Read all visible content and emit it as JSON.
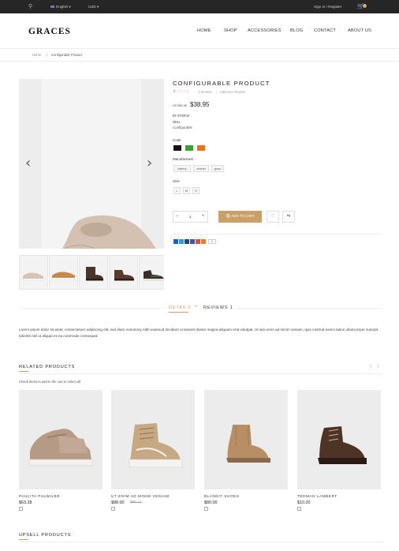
{
  "topbar": {
    "language": "English",
    "currency": "USD",
    "account_link": "Sign In / Register",
    "cart_count": "0"
  },
  "header": {
    "logo": "GRACES",
    "nav": [
      "HOME",
      "SHOP",
      "ACCESSORIES",
      "BLOG",
      "CONTACT",
      "ABOUT US"
    ]
  },
  "breadcrumb": [
    "Home",
    "Configurable Product"
  ],
  "product": {
    "title": "CONFIGURABLE PRODUCT",
    "review_count": "1 Review",
    "add_review": "Add Your Review",
    "price_prefix": "As low as",
    "price": "$38.95",
    "stock": "IN STOCK",
    "sku_label": "SKU",
    "sku_value": "Configurable",
    "color_label": "Color",
    "colors": [
      "#111111",
      "#3aa334",
      "#e8741f"
    ],
    "manufacturer_label": "Manufacturer",
    "manufacturer_required": "*",
    "manufacturers": [
      "bakery",
      "chanel",
      "gucci"
    ],
    "size_label": "Size",
    "sizes": [
      "L",
      "M",
      "S"
    ],
    "qty_minus": "−",
    "qty": "1",
    "qty_plus": "+",
    "add_to_cart": "ADD TO CART",
    "share_count": "0"
  },
  "tabs": {
    "details": "DETAILS",
    "reviews": "REVIEWS 1"
  },
  "description": "Lorem ipsum dolor sit amet, consectetuer adipiscing elit, sed diam nonummy nibh euismod tincidunt ut laoreet dolore magna aliquam erat volutpat. Ut wisi enim ad minim veniam, quis nostrud exerci tation ullamcorper suscipit lobortis nisl ut aliquip ex ea commodo consequat.",
  "related": {
    "title": "RELATED PRODUCTS",
    "hint": "Check items to add to the cart or select all",
    "items": [
      {
        "name": "PAULITA PULWILER",
        "price": "$63.28",
        "old_price": ""
      },
      {
        "name": "UT ENIM AD MINIM VENIAM",
        "price": "$88.00",
        "old_price": "$95.12"
      },
      {
        "name": "BLANDIT SHOES",
        "price": "$80.00",
        "old_price": ""
      },
      {
        "name": "TEDMAN LAMBERT",
        "price": "$10.20",
        "old_price": ""
      }
    ]
  },
  "upsell": {
    "title": "UPSELL PRODUCTS"
  }
}
